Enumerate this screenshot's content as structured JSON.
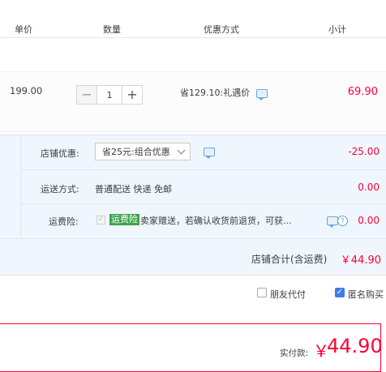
{
  "header": {
    "columns": [
      "单价",
      "数量",
      "优惠方式",
      "小计"
    ]
  },
  "item": {
    "unit_price": "199.00",
    "quantity": "1",
    "minus_symbol": "−",
    "plus_symbol": "+",
    "promotion": "省129.10:礼遇价",
    "subtotal": "69.90"
  },
  "shop": {
    "coupon_label": "店铺优惠:",
    "coupon_selected": "省25元:组合优惠",
    "coupon_amount": "-25.00",
    "shipping_label": "运送方式:",
    "shipping_value": "普通配送 快递 免邮",
    "shipping_amount": "0.00",
    "insurance_label": "运费险:",
    "insurance_badge": "运费险",
    "insurance_text": "卖家赠送，若确认收货前退货，可获...",
    "insurance_amount": "0.00",
    "total_label": "店铺合计(含运费)",
    "total_amount": "￥44.90"
  },
  "options": {
    "friend_pay": "朋友代付",
    "anonymous": "匿名购买"
  },
  "payment": {
    "label": "实付款:",
    "currency": "￥",
    "amount": "44.90"
  },
  "colors": {
    "accent_red": "#ff0036",
    "link_blue": "#3b7de9",
    "badge_green": "#3ca34a",
    "shop_bg": "#f0f6fd"
  },
  "icons": [
    "message-icon",
    "help-icon",
    "check-icon",
    "chevron-down-icon"
  ]
}
